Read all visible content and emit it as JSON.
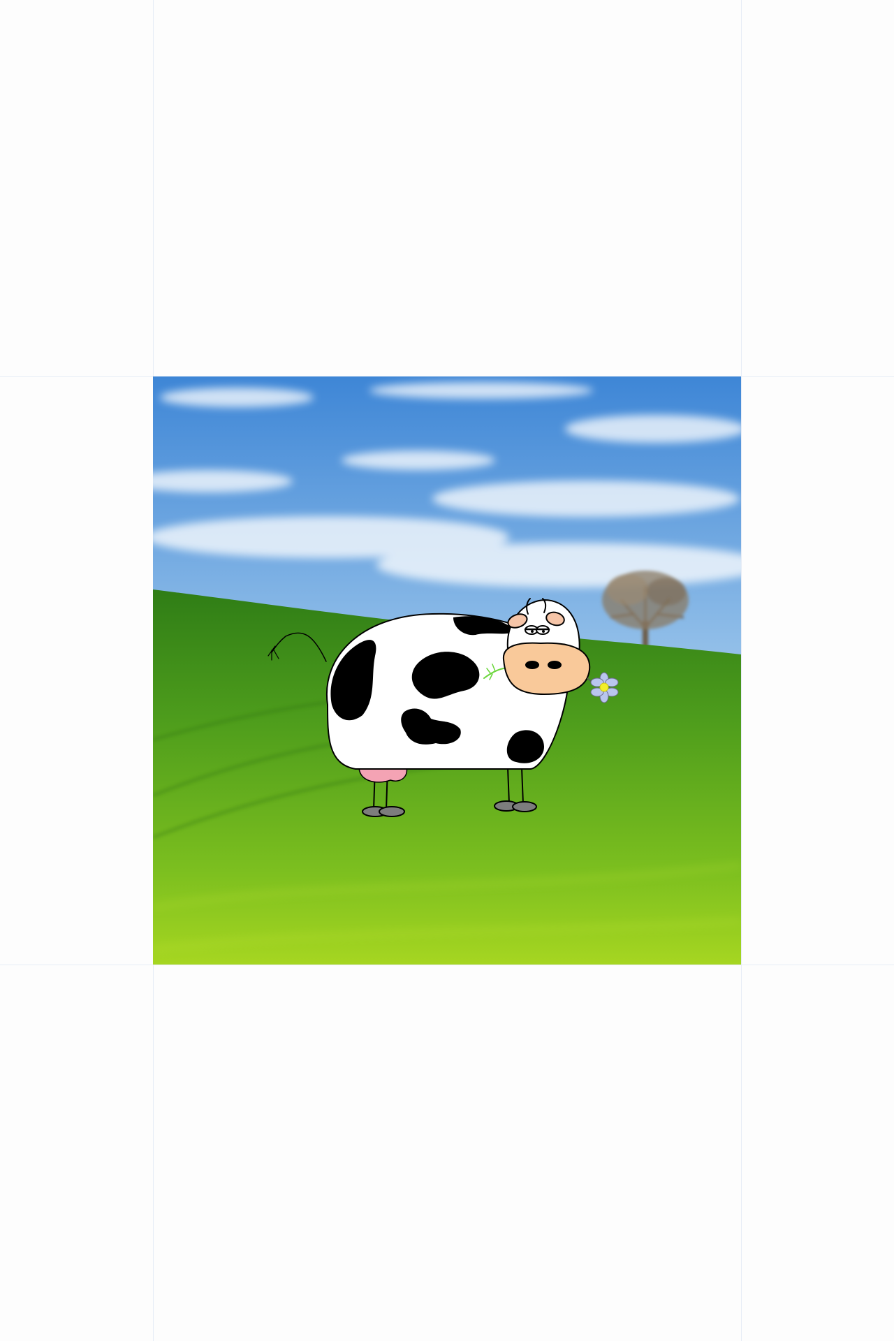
{
  "scene": {
    "subject": "cartoon-cow",
    "setting": "grass-field",
    "colors": {
      "page_bg": "#fdfdfd",
      "guide_line": "#e6edf6",
      "sky_top": "#3e86d6",
      "sky_bottom": "#eef5fb",
      "grass_far": "#3e8f1c",
      "grass_near": "#a6d621",
      "cow_body": "#ffffff",
      "cow_spots": "#000000",
      "cow_muzzle": "#f9c99a",
      "udder": "#f4a3b4",
      "hooves": "#7d7d7d",
      "flower_petals": "#b9c6ee",
      "flower_center": "#f2ee2a",
      "tree_trunk": "#6b5a44"
    }
  }
}
